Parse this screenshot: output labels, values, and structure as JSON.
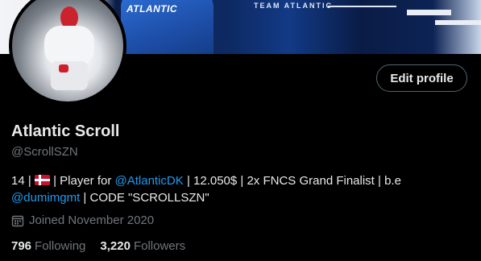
{
  "banner": {
    "jersey_text": "ATLANTIC",
    "team_text": "TEAM ATLANTIC"
  },
  "profile": {
    "display_name": "Atlantic Scroll",
    "handle": "@ScrollSZN",
    "edit_button_label": "Edit profile"
  },
  "bio": {
    "part1": "14 | ",
    "flag_icon": "denmark-flag-icon",
    "part2": " | Player for ",
    "mention1": "@AtlanticDK",
    "part3": " | 12.050$ | 2x FNCS Grand Finalist | b.e",
    "mention2": "@dumimgmt",
    "part4": " | CODE \"SCROLLSZN\""
  },
  "joined": {
    "icon": "calendar-icon",
    "text": "Joined November 2020"
  },
  "stats": {
    "following_count": "796",
    "following_label": "Following",
    "followers_count": "3,220",
    "followers_label": "Followers"
  },
  "colors": {
    "background": "#000000",
    "text": "#e7e9ea",
    "muted": "#71767b",
    "link": "#1d9bf0"
  }
}
